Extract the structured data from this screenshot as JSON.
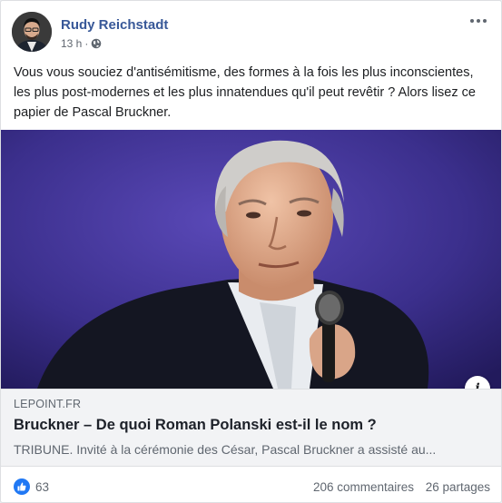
{
  "post": {
    "author": "Rudy Reichstadt",
    "time": "13 h",
    "separator": "·",
    "text": "Vous vous souciez d'antisémitisme, des formes à la fois les plus inconscientes, les plus post-modernes et les plus innatendues qu'il peut revêtir ? Alors lisez ce papier de Pascal Bruckner."
  },
  "link": {
    "domain": "LEPOINT.FR",
    "title": "Bruckner – De quoi Roman Polanski est-il le nom ?",
    "description": "TRIBUNE. Invité à la cérémonie des César, Pascal Bruckner a assisté au...",
    "info_label": "i"
  },
  "reactions": {
    "likes": "63",
    "comments": "206 commentaires",
    "shares": "26 partages"
  },
  "icons": {
    "privacy": "globe-icon",
    "more": "more-options-icon",
    "like": "thumbs-up-icon",
    "info": "info-icon"
  },
  "colors": {
    "author_link": "#385898",
    "like_blue": "#2078f4",
    "image_background": "#3b2f8c"
  }
}
